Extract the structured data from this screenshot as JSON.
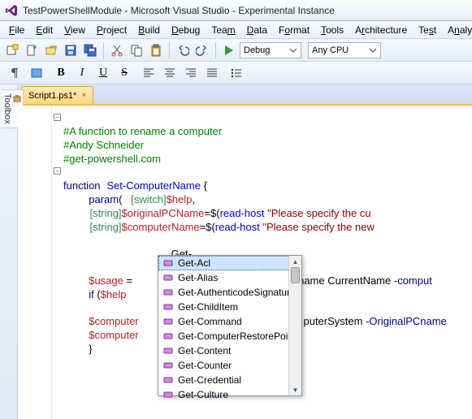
{
  "window": {
    "title": "TestPowerShellModule - Microsoft Visual Studio - Experimental Instance"
  },
  "menu": {
    "file": "File",
    "edit": "Edit",
    "view": "View",
    "project": "Project",
    "build": "Build",
    "debug": "Debug",
    "team": "Team",
    "data": "Data",
    "format": "Format",
    "tools": "Tools",
    "architecture": "Architecture",
    "test": "Test",
    "analyze": "Analyze"
  },
  "toolbar": {
    "config_label": "Debug",
    "platform_label": "Any CPU"
  },
  "toolbox": {
    "label": "Toolbox"
  },
  "tab": {
    "label": "Script1.ps1*",
    "close": "×"
  },
  "code": {
    "l1": "#A function to rename a computer",
    "l2": "#Andy Schneider",
    "l3": "#get-powershell.com",
    "l5_kw": "function",
    "l5_name": "Set-ComputerName",
    "l5_brace": " {",
    "l6_kw": "param",
    "l6_open": "(   ",
    "l6_type": "[switch]",
    "l6_var": "$help",
    "l6_comma": ",",
    "l7_pad": "         ",
    "l7_type": "[string]",
    "l7_var": "$originalPCName",
    "l7_eq": "=$(",
    "l7_cmd": "read-host",
    "l7_str": " \"Please specify the cu",
    "l8_pad": "         ",
    "l8_type": "[string]",
    "l8_var": "$computerName",
    "l8_eq": "=$(",
    "l8_cmd": "read-host",
    "l8_str": " \"Please specify the new",
    "l10_typed": "Get-",
    "l12_var": "$usage",
    "l12_eq": " = ",
    "l12_rest1": "lPCname CurrentName ",
    "l12_rest2": "-comput",
    "l13_kw": "if",
    "l13_open": " (",
    "l13_var": "$help",
    "l13_close": "}",
    "l15_var": "$computer",
    "l15_rest1": "puterSystem ",
    "l15_rest2": "-OriginalPCname",
    "l16_var": "$computer",
    "l17_brace": "}"
  },
  "intellisense": {
    "items": [
      "Get-Acl",
      "Get-Alias",
      "Get-AuthenticodeSignature",
      "Get-ChildItem",
      "Get-Command",
      "Get-ComputerRestorePoint",
      "Get-Content",
      "Get-Counter",
      "Get-Credential",
      "Get-Culture"
    ]
  }
}
